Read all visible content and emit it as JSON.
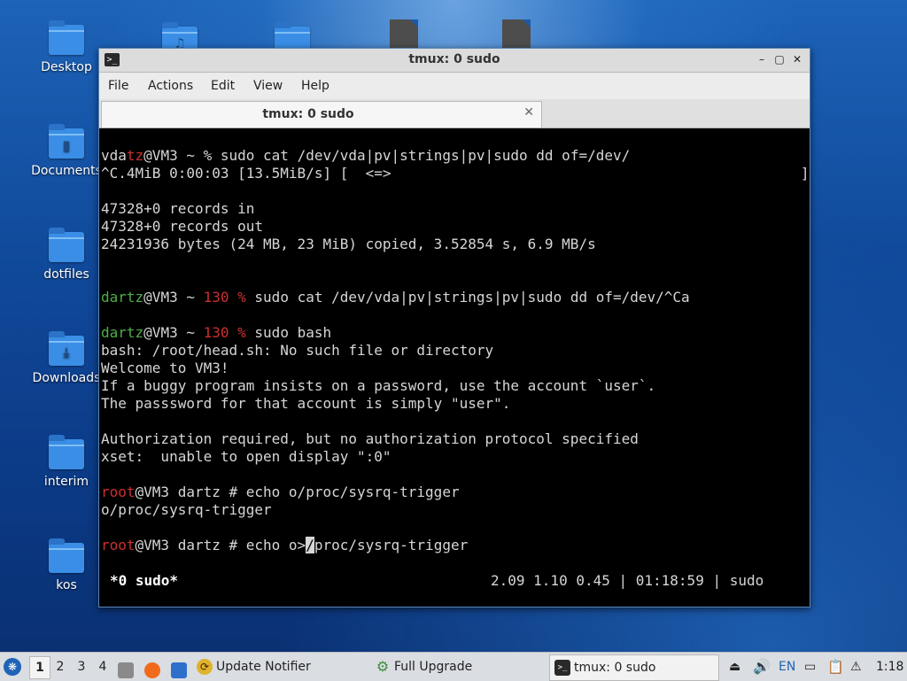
{
  "desktop": {
    "icons": [
      {
        "label": "Desktop"
      },
      {
        "label": "Documents"
      },
      {
        "label": "dotfiles"
      },
      {
        "label": "Downloads"
      },
      {
        "label": "interim"
      },
      {
        "label": "kos"
      }
    ]
  },
  "window": {
    "title": "tmux: 0 sudo",
    "menu": [
      "File",
      "Actions",
      "Edit",
      "View",
      "Help"
    ],
    "tab_title": "tmux: 0 sudo",
    "terminal": {
      "l1_user_a": "vda",
      "l1_user_b": "tz",
      "l1_rest": "@VM3 ~ % sudo cat /dev/vda|pv|strings|pv|sudo dd of=/dev/",
      "l2": "^C.4MiB 0:00:03 [13.5MiB/s] [  <=>                                                ]",
      "l3": "47328+0 records in",
      "l4": "47328+0 records out",
      "l5": "24231936 bytes (24 MB, 23 MiB) copied, 3.52854 s, 6.9 MB/s",
      "l6_user": "dartz",
      "l6_host": "@VM3 ~ ",
      "l6_code": "130 %",
      "l6_cmd": " sudo cat /dev/vda|pv|strings|pv|sudo dd of=/dev/^Ca",
      "l7_user": "dartz",
      "l7_host": "@VM3 ~ ",
      "l7_code": "130 %",
      "l7_cmd": " sudo bash",
      "l8": "bash: /root/head.sh: No such file or directory",
      "l9": "Welcome to VM3!",
      "l10": "If a buggy program insists on a password, use the account `user`.",
      "l11": "The passsword for that account is simply \"user\".",
      "l12": "Authorization required, but no authorization protocol specified",
      "l13": "xset:  unable to open display \":0\"",
      "l14_user": "root",
      "l14_rest": "@VM3 dartz # echo o/proc/sysrq-trigger",
      "l15": "o/proc/sysrq-trigger",
      "l16_user": "root",
      "l16_pre": "@VM3 dartz # echo o>",
      "l16_cursor": "/",
      "l16_post": "proc/sysrq-trigger",
      "status_left": "*0 sudo*",
      "status_right": "2.09 1.10 0.45 | 01:18:59 | sudo"
    }
  },
  "taskbar": {
    "workspaces": [
      "1",
      "2",
      "3",
      "4"
    ],
    "tasks": [
      {
        "label": "Update Notifier"
      },
      {
        "label": "Full Upgrade"
      },
      {
        "label": "tmux: 0 sudo"
      }
    ],
    "language": "EN",
    "clock": "1:18"
  },
  "colors": {
    "prompt_red": "#cc2f2f",
    "user_green": "#4fae45",
    "window_border": "#5a86b8"
  }
}
